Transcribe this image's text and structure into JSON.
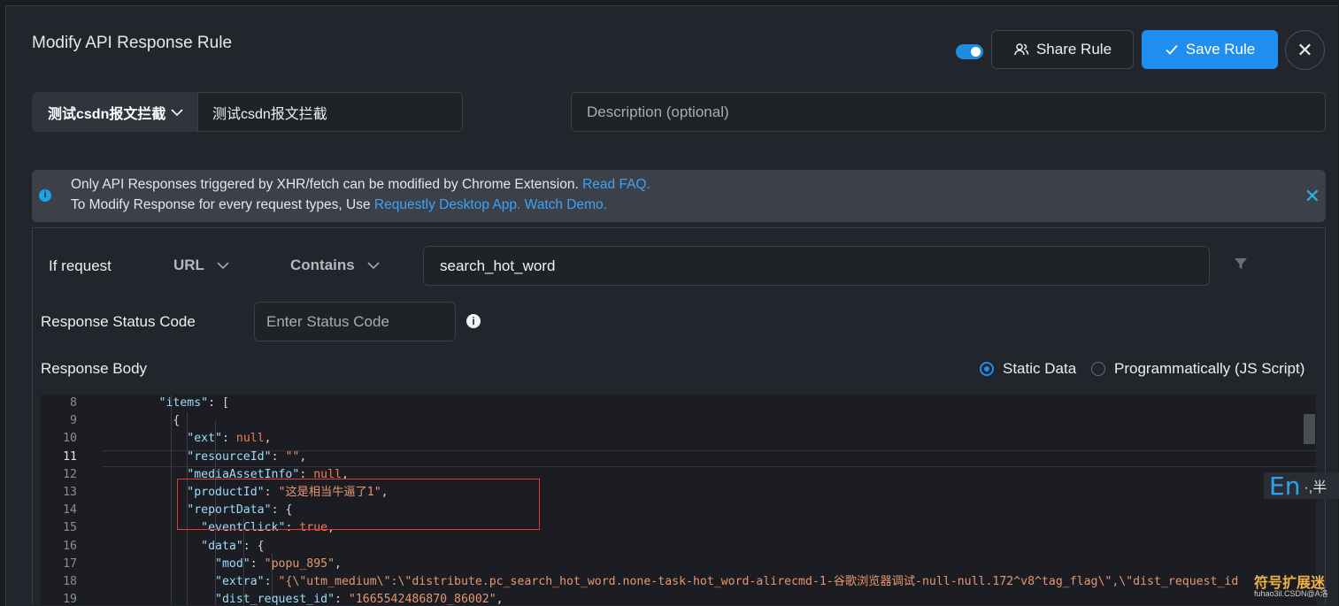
{
  "header": {
    "title": "Modify API Response Rule",
    "share_label": "Share Rule",
    "save_label": "Save Rule",
    "close_symbol": "✕",
    "toggle_on": true
  },
  "group": {
    "selected": "测试csdn报文拦截",
    "name_value": "测试csdn报文拦截",
    "description_placeholder": "Description (optional)"
  },
  "banner": {
    "line1_text": "Only API Responses triggered by XHR/fetch can be modified by Chrome Extension.",
    "line1_link": "Read FAQ.",
    "line2_text": "To Modify Response for every request types, Use",
    "line2_link1": "Requestly Desktop App.",
    "line2_link2": "Watch Demo."
  },
  "rule": {
    "if_request_label": "If request",
    "source_key": "URL",
    "operator": "Contains",
    "url_value": "search_hot_word",
    "status_label": "Response Status Code",
    "status_placeholder": "Enter Status Code",
    "body_label": "Response Body",
    "option_static": "Static Data",
    "option_programmatic": "Programmatically (JS Script)",
    "selected_option": "Static Data"
  },
  "editor": {
    "current_line": 11,
    "lines": [
      {
        "num": "8",
        "parts": [
          [
            "p",
            "        "
          ],
          [
            "k",
            "\"items\""
          ],
          [
            "p",
            ": ["
          ]
        ]
      },
      {
        "num": "9",
        "parts": [
          [
            "p",
            "          {"
          ]
        ]
      },
      {
        "num": "10",
        "parts": [
          [
            "p",
            "            "
          ],
          [
            "k",
            "\"ext\""
          ],
          [
            "p",
            ": "
          ],
          [
            "n",
            "null"
          ],
          [
            "p",
            ","
          ]
        ]
      },
      {
        "num": "11",
        "parts": [
          [
            "p",
            "            "
          ],
          [
            "k",
            "\"resourceId\""
          ],
          [
            "p",
            ": "
          ],
          [
            "s",
            "\"\""
          ],
          [
            "p",
            ","
          ]
        ]
      },
      {
        "num": "12",
        "parts": [
          [
            "p",
            "            "
          ],
          [
            "k",
            "\"mediaAssetInfo\""
          ],
          [
            "p",
            ": "
          ],
          [
            "n",
            "null"
          ],
          [
            "p",
            ","
          ]
        ]
      },
      {
        "num": "13",
        "parts": [
          [
            "p",
            "            "
          ],
          [
            "k",
            "\"productId\""
          ],
          [
            "p",
            ": "
          ],
          [
            "s",
            "\"这是相当牛逼了1\""
          ],
          [
            "p",
            ","
          ]
        ]
      },
      {
        "num": "14",
        "parts": [
          [
            "p",
            "            "
          ],
          [
            "k",
            "\"reportData\""
          ],
          [
            "p",
            ": {"
          ]
        ]
      },
      {
        "num": "15",
        "parts": [
          [
            "p",
            "              "
          ],
          [
            "k",
            "\"eventClick\""
          ],
          [
            "p",
            ": "
          ],
          [
            "n",
            "true"
          ],
          [
            "p",
            ","
          ]
        ]
      },
      {
        "num": "16",
        "parts": [
          [
            "p",
            "              "
          ],
          [
            "k",
            "\"data\""
          ],
          [
            "p",
            ": {"
          ]
        ]
      },
      {
        "num": "17",
        "parts": [
          [
            "p",
            "                "
          ],
          [
            "k",
            "\"mod\""
          ],
          [
            "p",
            ": "
          ],
          [
            "s",
            "\"popu_895\""
          ],
          [
            "p",
            ","
          ]
        ]
      },
      {
        "num": "18",
        "parts": [
          [
            "p",
            "                "
          ],
          [
            "k",
            "\"extra\""
          ],
          [
            "p",
            ": "
          ],
          [
            "s",
            "\"{\\\"utm_medium\\\":\\\"distribute.pc_search_hot_word.none-task-hot_word-alirecmd-1-谷歌浏览器调试-null-null.172^v8^tag_flag\\\",\\\"dist_request_id"
          ]
        ]
      },
      {
        "num": "19",
        "parts": [
          [
            "p",
            "                "
          ],
          [
            "k",
            "\"dist_request_id\""
          ],
          [
            "p",
            ": "
          ],
          [
            "s",
            "\"1665542486870_86002\""
          ],
          [
            "p",
            ","
          ]
        ]
      }
    ]
  },
  "ime": {
    "lang": "En",
    "rest": "·,半"
  },
  "watermark": {
    "line1": "符号扩展迷",
    "line2": "fuhao3il.CSDN@A洛"
  }
}
